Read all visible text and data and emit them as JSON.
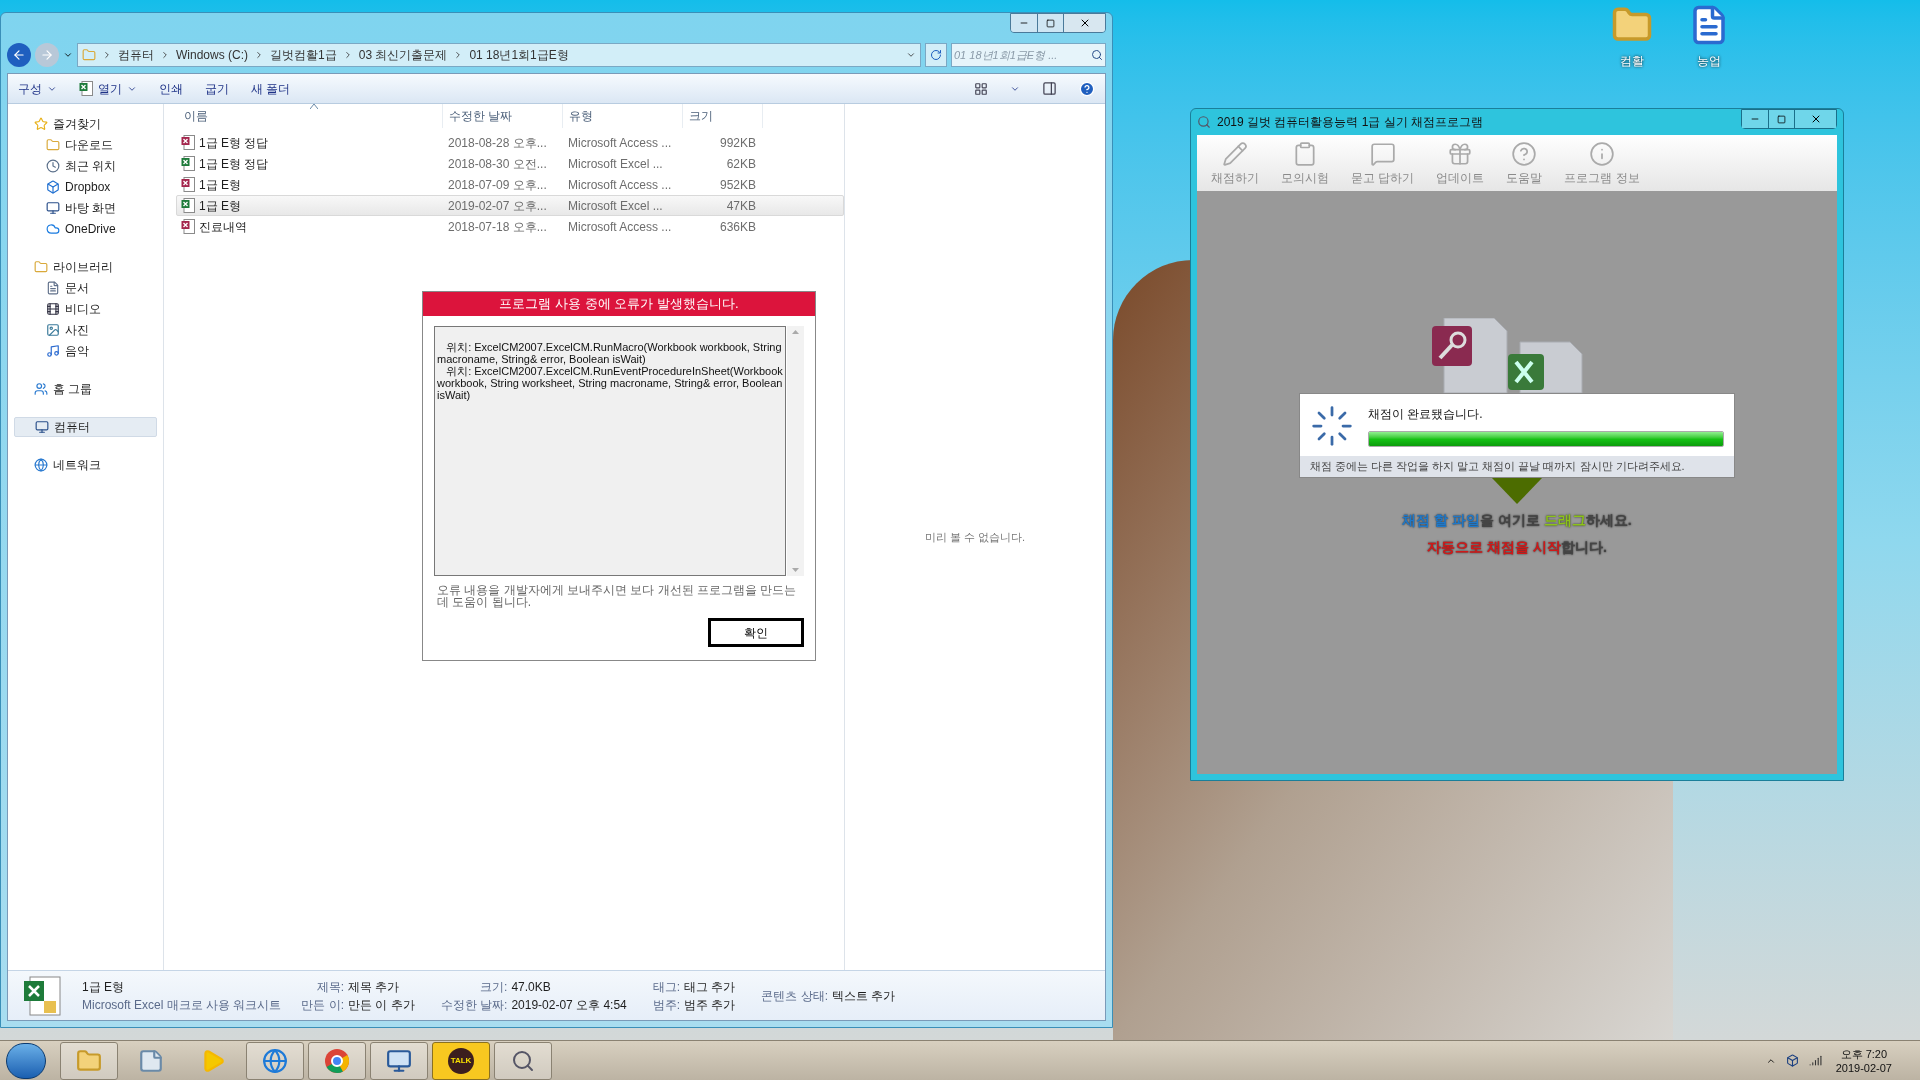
{
  "desktop_icons": [
    {
      "label": "컴활",
      "kind": "folder"
    },
    {
      "label": "농업",
      "kind": "document"
    }
  ],
  "explorer": {
    "breadcrumb": [
      "컴퓨터",
      "Windows (C:)",
      "길벗컴활1급",
      "03 최신기출문제",
      "01 18년1회1급E형"
    ],
    "search": {
      "placeholder": "01 18년1회1급E형 ..."
    },
    "toolbar": [
      {
        "label": "구성",
        "dropdown": true,
        "kind": "text"
      },
      {
        "label": "열기",
        "dropdown": true,
        "kind": "excel"
      },
      {
        "label": "인쇄",
        "dropdown": false,
        "kind": "text"
      },
      {
        "label": "굽기",
        "dropdown": false,
        "kind": "text"
      },
      {
        "label": "새 폴더",
        "dropdown": false,
        "kind": "text"
      }
    ],
    "sidebar": [
      {
        "label": "즐겨찾기",
        "selected": false,
        "children": [
          {
            "label": "다운로드",
            "selected": false
          },
          {
            "label": "최근 위치",
            "selected": false
          },
          {
            "label": "Dropbox",
            "selected": false
          },
          {
            "label": "바탕 화면",
            "selected": false
          },
          {
            "label": "OneDrive",
            "selected": false
          }
        ]
      },
      {
        "label": "라이브러리",
        "selected": false,
        "children": [
          {
            "label": "문서",
            "selected": false
          },
          {
            "label": "비디오",
            "selected": false
          },
          {
            "label": "사진",
            "selected": false
          },
          {
            "label": "음악",
            "selected": false
          }
        ]
      },
      {
        "label": "홈 그룹",
        "selected": false
      },
      {
        "label": "컴퓨터",
        "selected": true
      },
      {
        "label": "네트워크",
        "selected": false
      }
    ],
    "columns": [
      {
        "label": "이름",
        "sorted": true
      },
      {
        "label": "수정한 날짜",
        "sorted": false
      },
      {
        "label": "유형",
        "sorted": false
      },
      {
        "label": "크기",
        "sorted": false
      }
    ],
    "files": [
      {
        "name": "1급 E형 정답",
        "date": "2018-08-28 오후...",
        "type": "Microsoft Access ...",
        "size": "992KB",
        "kind": "access",
        "selected": false
      },
      {
        "name": "1급 E형 정답",
        "date": "2018-08-30 오전...",
        "type": "Microsoft Excel ...",
        "size": "62KB",
        "kind": "excel",
        "selected": false
      },
      {
        "name": "1급 E형",
        "date": "2018-07-09 오후...",
        "type": "Microsoft Access ...",
        "size": "952KB",
        "kind": "access",
        "selected": false
      },
      {
        "name": "1급 E형",
        "date": "2019-02-07 오후...",
        "type": "Microsoft Excel ...",
        "size": "47KB",
        "kind": "excel",
        "selected": true
      },
      {
        "name": "진료내역",
        "date": "2018-07-18 오후...",
        "type": "Microsoft Access ...",
        "size": "636KB",
        "kind": "access",
        "selected": false
      }
    ],
    "preview_message": "미리 볼 수 없습니다.",
    "details": {
      "name": "1급 E형",
      "type": "Microsoft Excel 매크로 사용 워크시트",
      "fields": [
        [
          {
            "label": "제목:",
            "value": "제목 추가"
          },
          {
            "label": "만든 이:",
            "value": "만든 이 추가"
          }
        ],
        [
          {
            "label": "크기:",
            "value": "47.0KB"
          },
          {
            "label": "수정한 날짜:",
            "value": "2019-02-07 오후 4:54"
          }
        ],
        [
          {
            "label": "태그:",
            "value": "태그 추가"
          },
          {
            "label": "범주:",
            "value": "범주 추가"
          }
        ],
        [
          {
            "label": "콘텐츠 상태:",
            "value": "텍스트 추가"
          }
        ]
      ]
    }
  },
  "error_dialog": {
    "title": "프로그램 사용 중에 오류가 발생했습니다.",
    "message": "\n   위치: ExcelCM2007.ExcelCM.RunMacro(Workbook workbook, String macroname, String& error, Boolean isWait)\n   위치: ExcelCM2007.ExcelCM.RunEventProcedureInSheet(Workbook workbook, String worksheet, String macroname, String& error, Boolean isWait)",
    "note": "오류 내용을 개발자에게 보내주시면 보다 개선된 프로그램을 만드는데 도움이 됩니다.",
    "button": "확인"
  },
  "grader": {
    "title": "2019 길벗 컴퓨터활용능력 1급 실기 채점프로그램",
    "toolbar": [
      "채점하기",
      "모의시험",
      "묻고 답하기",
      "업데이트",
      "도움말",
      "프로그램 정보"
    ],
    "progress": {
      "message": "채점이 완료됐습니다.",
      "level": 1,
      "hint": "채점 중에는 다른 작업을 하지 말고 채점이 끝날 때까지 잠시만 기다려주세요."
    },
    "drop_hint": [
      [
        {
          "text": "채점 할 파일",
          "color": "#1f78c8"
        },
        {
          "text": "을 여기로 "
        },
        {
          "text": "드래그",
          "color": "#8cc21a"
        },
        {
          "text": "하세요."
        }
      ],
      [
        {
          "text": "자동으로 채점을 시작",
          "color": "#d01818"
        },
        {
          "text": "합니다."
        }
      ]
    ]
  },
  "taskbar": {
    "items": [
      {
        "kind": "explorer",
        "open": true
      },
      {
        "kind": "notepad",
        "open": false
      },
      {
        "kind": "media",
        "open": false
      },
      {
        "kind": "ie",
        "open": true
      },
      {
        "kind": "chrome",
        "open": true
      },
      {
        "kind": "remote",
        "open": true
      },
      {
        "kind": "kakao",
        "open": true,
        "label": "TALK"
      },
      {
        "kind": "grader",
        "open": true
      }
    ],
    "time": "오후 7:20",
    "date": "2019-02-07"
  }
}
